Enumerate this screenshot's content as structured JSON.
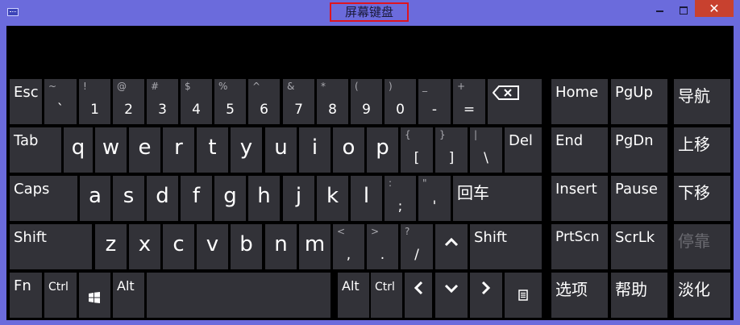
{
  "window": {
    "title": "屏幕键盘",
    "app_icon": "keyboard-icon",
    "controls": {
      "minimize": "minimize-icon",
      "maximize": "maximize-icon",
      "close": "✕"
    }
  },
  "colors": {
    "frame": "#6b6bdc",
    "board_bg": "#000000",
    "key_bg": "#323238",
    "key_text": "#ffffff",
    "key_secondary_text": "#aaaab0",
    "key_disabled_text": "#6a6a70",
    "close_button": "#c8412f",
    "title_highlight": "#e0141e"
  },
  "keys": {
    "esc": "Esc",
    "tab": "Tab",
    "del": "Del",
    "caps": "Caps",
    "enter": "回车",
    "shift": "Shift",
    "fn": "Fn",
    "ctrl": "Ctrl",
    "alt": "Alt",
    "backspace_icon": "backspace-icon",
    "windows_icon": "windows-logo-icon",
    "menu_icon": "context-menu-icon",
    "up_icon": "arrow-up-icon",
    "left_icon": "arrow-left-icon",
    "down_icon": "arrow-down-icon",
    "right_icon": "arrow-right-icon",
    "numbers": [
      {
        "shift": "~",
        "main": "`"
      },
      {
        "shift": "!",
        "main": "1"
      },
      {
        "shift": "@",
        "main": "2"
      },
      {
        "shift": "#",
        "main": "3"
      },
      {
        "shift": "$",
        "main": "4"
      },
      {
        "shift": "%",
        "main": "5"
      },
      {
        "shift": "^",
        "main": "6"
      },
      {
        "shift": "&",
        "main": "7"
      },
      {
        "shift": "*",
        "main": "8"
      },
      {
        "shift": "(",
        "main": "9"
      },
      {
        "shift": ")",
        "main": "0"
      },
      {
        "shift": "_",
        "main": "-"
      },
      {
        "shift": "+",
        "main": "="
      }
    ],
    "row_q": [
      "q",
      "w",
      "e",
      "r",
      "t",
      "y",
      "u",
      "i",
      "o",
      "p"
    ],
    "row_q_symbols": [
      {
        "shift": "{",
        "main": "["
      },
      {
        "shift": "}",
        "main": "]"
      },
      {
        "shift": "|",
        "main": "\\"
      }
    ],
    "row_a": [
      "a",
      "s",
      "d",
      "f",
      "g",
      "h",
      "j",
      "k",
      "l"
    ],
    "row_a_symbols": [
      {
        "shift": ":",
        "main": ";"
      },
      {
        "shift": "\"",
        "main": "'"
      }
    ],
    "row_z": [
      "z",
      "x",
      "c",
      "v",
      "b",
      "n",
      "m"
    ],
    "row_z_symbols": [
      {
        "shift": "<",
        "main": ","
      },
      {
        "shift": ">",
        "main": "."
      },
      {
        "shift": "?",
        "main": "/"
      }
    ]
  },
  "nav": {
    "home": "Home",
    "pgup": "PgUp",
    "navigate": "导航",
    "end": "End",
    "pgdn": "PgDn",
    "move_up": "上移",
    "insert": "Insert",
    "pause": "Pause",
    "move_down": "下移",
    "prtscn": "PrtScn",
    "scrlk": "ScrLk",
    "dock": "停靠",
    "options": "选项",
    "help": "帮助",
    "fade": "淡化"
  }
}
